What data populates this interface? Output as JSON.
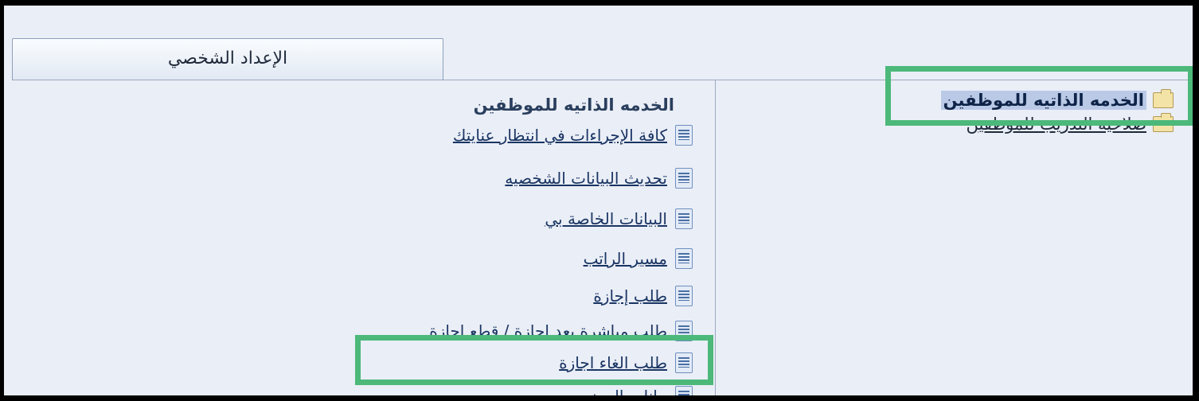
{
  "tabs": {
    "personal_settings": "الإعداد الشخصي"
  },
  "navigator": {
    "items": [
      {
        "label": "الخدمه الذاتيه للموظفين",
        "selected": true
      },
      {
        "label": "صلاحيه التدريب للموظفين",
        "selected": false
      }
    ]
  },
  "content": {
    "title": "الخدمه الذاتيه للموظفين",
    "links": [
      {
        "label": "كافة الإجراءات في انتظار عنايتك"
      },
      {
        "label": "تحديث البيانات الشخصيه"
      },
      {
        "label": "البيانات الخاصة بي"
      },
      {
        "label": "مسير الراتب"
      },
      {
        "label": "طلب إجازة"
      },
      {
        "label": "طلب مباشرة بعد اجازة / قطع اجازة"
      },
      {
        "label": "طلب الغاء اجازة"
      },
      {
        "label": "بيانات الحضور"
      }
    ]
  },
  "colors": {
    "highlight": "#4cb87a",
    "selection": "#b9c9e6",
    "link": "#1a3564"
  }
}
